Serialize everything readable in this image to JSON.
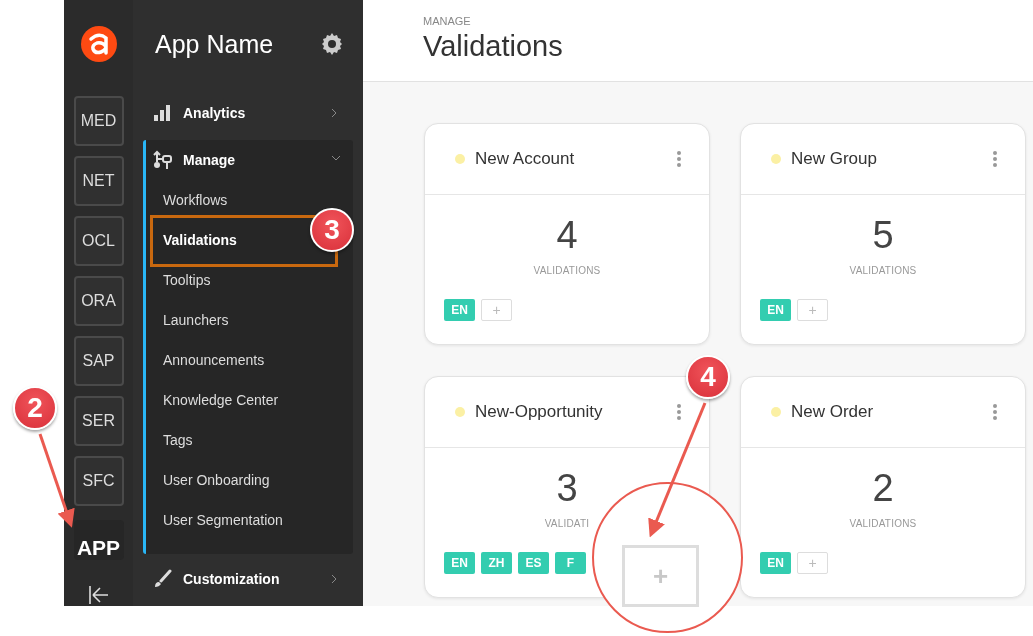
{
  "rail": {
    "items": [
      {
        "label": "MED",
        "selected": false
      },
      {
        "label": "NET",
        "selected": false
      },
      {
        "label": "OCL",
        "selected": false
      },
      {
        "label": "ORA",
        "selected": false
      },
      {
        "label": "SAP",
        "selected": false
      },
      {
        "label": "SER",
        "selected": false
      },
      {
        "label": "SFC",
        "selected": false
      },
      {
        "label": "APP",
        "selected": true
      }
    ]
  },
  "sidebar": {
    "title": "App Name",
    "sections": [
      {
        "kind": "chart",
        "label": "Analytics",
        "expanded": false
      },
      {
        "kind": "flow",
        "label": "Manage",
        "expanded": true,
        "children": [
          {
            "label": "Workflows",
            "selected": false
          },
          {
            "label": "Validations",
            "selected": true
          },
          {
            "label": "Tooltips",
            "selected": false
          },
          {
            "label": "Launchers",
            "selected": false
          },
          {
            "label": "Announcements",
            "selected": false
          },
          {
            "label": "Knowledge Center",
            "selected": false
          },
          {
            "label": "Tags",
            "selected": false
          },
          {
            "label": "User Onboarding",
            "selected": false
          },
          {
            "label": "User Segmentation",
            "selected": false
          }
        ]
      },
      {
        "kind": "brush",
        "label": "Customization",
        "expanded": false
      }
    ]
  },
  "header": {
    "eyebrow": "MANAGE",
    "title": "Validations"
  },
  "cards": [
    {
      "title": "New Account",
      "count": "4",
      "count_label": "VALIDATIONS",
      "languages": [
        "EN"
      ],
      "add_label": "+"
    },
    {
      "title": "New Group",
      "count": "5",
      "count_label": "VALIDATIONS",
      "languages": [
        "EN"
      ],
      "add_label": "+"
    },
    {
      "title": "New-Opportunity",
      "count": "3",
      "count_label": "VALIDATI",
      "languages": [
        "EN",
        "ZH",
        "ES",
        "F"
      ]
    },
    {
      "title": "New Order",
      "count": "2",
      "count_label": "VALIDATIONS",
      "languages": [
        "EN"
      ],
      "add_label": "+"
    }
  ],
  "annotations": [
    {
      "number": "2"
    },
    {
      "number": "3"
    },
    {
      "number": "4"
    }
  ],
  "magnifier": {
    "add_label": "+"
  }
}
